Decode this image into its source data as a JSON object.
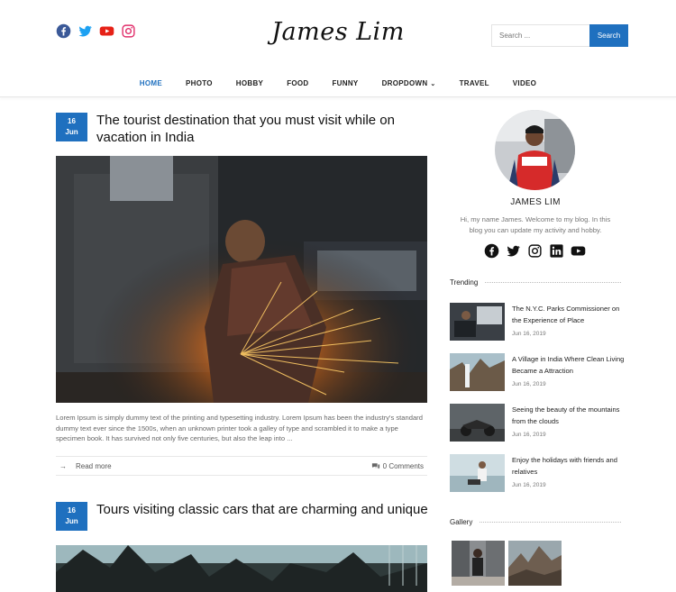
{
  "header": {
    "logo": "James Lim",
    "search_placeholder": "Search ...",
    "search_button": "Search",
    "social_icons": [
      "facebook-icon",
      "twitter-icon",
      "youtube-icon",
      "instagram-icon"
    ]
  },
  "nav": [
    {
      "label": "HOME",
      "active": true
    },
    {
      "label": "PHOTO"
    },
    {
      "label": "HOBBY"
    },
    {
      "label": "FOOD"
    },
    {
      "label": "FUNNY"
    },
    {
      "label": "DROPDOWN",
      "has_dropdown": true
    },
    {
      "label": "TRAVEL"
    },
    {
      "label": "VIDEO"
    }
  ],
  "posts": [
    {
      "day": "16",
      "month": "Jun",
      "title": "The tourist destination that you must visit while on vacation in India",
      "excerpt": "Lorem Ipsum is simply dummy text of the printing and typesetting industry. Lorem Ipsum has been the industry's standard dummy text ever since the 1500s, when an unknown printer took a galley of type and scrambled it to make a type specimen book. It has survived not only five centuries, but also the leap into ...",
      "read_more": "Read more",
      "comments": "0 Comments"
    },
    {
      "day": "16",
      "month": "Jun",
      "title": "Tours visiting classic cars that are charming and unique"
    }
  ],
  "sidebar": {
    "name": "JAMES LIM",
    "bio": "Hi, my name James. Welcome to my blog. In this blog you can update my activity and hobby.",
    "social_icons": [
      "facebook-icon",
      "twitter-icon",
      "instagram-icon",
      "linkedin-icon",
      "youtube-icon"
    ],
    "trending_title": "Trending",
    "trending": [
      {
        "title": "The N.Y.C. Parks Commissioner on the Experience of Place",
        "date": "Jun 16, 2019"
      },
      {
        "title": "A Village in India Where Clean Living Became a Attraction",
        "date": "Jun 16, 2019"
      },
      {
        "title": "Seeing the beauty of the mountains from the clouds",
        "date": "Jun 16, 2019"
      },
      {
        "title": "Enjoy the holidays with friends and relatives",
        "date": "Jun 16, 2019"
      }
    ],
    "gallery_title": "Gallery"
  },
  "colors": {
    "accent": "#1f70bf",
    "facebook": "#3b5998",
    "twitter": "#1da1f2",
    "youtube": "#e62117",
    "instagram": "#e1306c"
  }
}
